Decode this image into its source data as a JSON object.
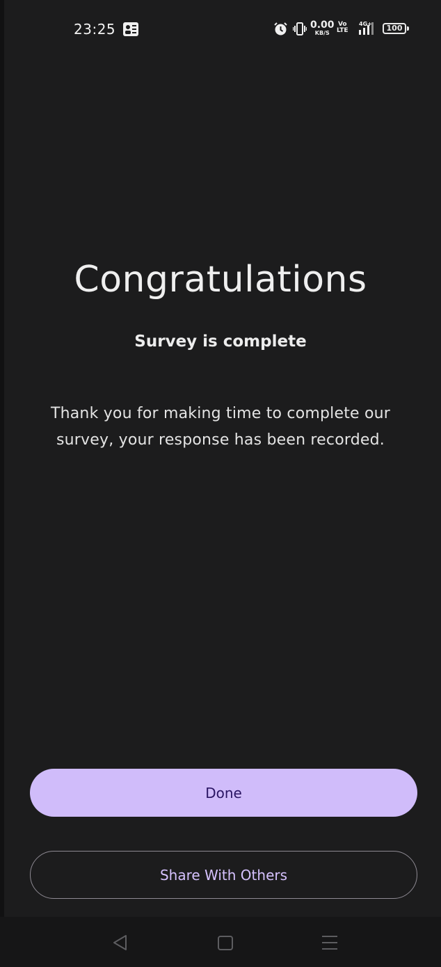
{
  "status_bar": {
    "time": "23:25",
    "net_speed_value": "0.00",
    "net_speed_unit": "KB/S",
    "volte_top": "Vo",
    "volte_bottom": "LTE",
    "signal_label": "4G+",
    "battery_level": "100",
    "icons": [
      "notification-app-icon",
      "alarm-icon",
      "vibrate-icon",
      "signal-icon"
    ]
  },
  "main": {
    "title": "Congratulations",
    "subtitle": "Survey is complete",
    "message": "Thank you for making time to complete our survey, your response has been recorded."
  },
  "actions": {
    "done_label": "Done",
    "share_label": "Share With Others"
  },
  "nav_bar": {
    "icons": [
      "back-icon",
      "home-icon",
      "menu-icon"
    ]
  },
  "colors": {
    "background": "#1c1c1d",
    "primary_button": "#d0bcfa",
    "primary_button_text": "#2a1563",
    "secondary_button_text": "#d6c2ff",
    "outline": "#8e8a93",
    "text": "#efefef"
  }
}
